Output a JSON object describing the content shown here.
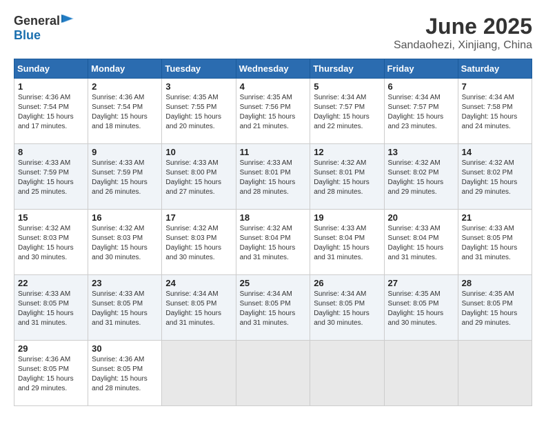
{
  "header": {
    "logo_general": "General",
    "logo_blue": "Blue",
    "title": "June 2025",
    "subtitle": "Sandaohezi, Xinjiang, China"
  },
  "calendar": {
    "days_of_week": [
      "Sunday",
      "Monday",
      "Tuesday",
      "Wednesday",
      "Thursday",
      "Friday",
      "Saturday"
    ],
    "weeks": [
      [
        null,
        {
          "day": "2",
          "sunrise": "4:36 AM",
          "sunset": "7:54 PM",
          "daylight": "15 hours and 18 minutes."
        },
        {
          "day": "3",
          "sunrise": "4:35 AM",
          "sunset": "7:55 PM",
          "daylight": "15 hours and 20 minutes."
        },
        {
          "day": "4",
          "sunrise": "4:35 AM",
          "sunset": "7:56 PM",
          "daylight": "15 hours and 21 minutes."
        },
        {
          "day": "5",
          "sunrise": "4:34 AM",
          "sunset": "7:57 PM",
          "daylight": "15 hours and 22 minutes."
        },
        {
          "day": "6",
          "sunrise": "4:34 AM",
          "sunset": "7:57 PM",
          "daylight": "15 hours and 23 minutes."
        },
        {
          "day": "7",
          "sunrise": "4:34 AM",
          "sunset": "7:58 PM",
          "daylight": "15 hours and 24 minutes."
        }
      ],
      [
        {
          "day": "1",
          "sunrise": "4:36 AM",
          "sunset": "7:54 PM",
          "daylight": "15 hours and 17 minutes."
        },
        null,
        null,
        null,
        null,
        null,
        null
      ],
      [
        {
          "day": "8",
          "sunrise": "4:33 AM",
          "sunset": "7:59 PM",
          "daylight": "15 hours and 25 minutes."
        },
        {
          "day": "9",
          "sunrise": "4:33 AM",
          "sunset": "7:59 PM",
          "daylight": "15 hours and 26 minutes."
        },
        {
          "day": "10",
          "sunrise": "4:33 AM",
          "sunset": "8:00 PM",
          "daylight": "15 hours and 27 minutes."
        },
        {
          "day": "11",
          "sunrise": "4:33 AM",
          "sunset": "8:01 PM",
          "daylight": "15 hours and 28 minutes."
        },
        {
          "day": "12",
          "sunrise": "4:32 AM",
          "sunset": "8:01 PM",
          "daylight": "15 hours and 28 minutes."
        },
        {
          "day": "13",
          "sunrise": "4:32 AM",
          "sunset": "8:02 PM",
          "daylight": "15 hours and 29 minutes."
        },
        {
          "day": "14",
          "sunrise": "4:32 AM",
          "sunset": "8:02 PM",
          "daylight": "15 hours and 29 minutes."
        }
      ],
      [
        {
          "day": "15",
          "sunrise": "4:32 AM",
          "sunset": "8:03 PM",
          "daylight": "15 hours and 30 minutes."
        },
        {
          "day": "16",
          "sunrise": "4:32 AM",
          "sunset": "8:03 PM",
          "daylight": "15 hours and 30 minutes."
        },
        {
          "day": "17",
          "sunrise": "4:32 AM",
          "sunset": "8:03 PM",
          "daylight": "15 hours and 30 minutes."
        },
        {
          "day": "18",
          "sunrise": "4:32 AM",
          "sunset": "8:04 PM",
          "daylight": "15 hours and 31 minutes."
        },
        {
          "day": "19",
          "sunrise": "4:33 AM",
          "sunset": "8:04 PM",
          "daylight": "15 hours and 31 minutes."
        },
        {
          "day": "20",
          "sunrise": "4:33 AM",
          "sunset": "8:04 PM",
          "daylight": "15 hours and 31 minutes."
        },
        {
          "day": "21",
          "sunrise": "4:33 AM",
          "sunset": "8:05 PM",
          "daylight": "15 hours and 31 minutes."
        }
      ],
      [
        {
          "day": "22",
          "sunrise": "4:33 AM",
          "sunset": "8:05 PM",
          "daylight": "15 hours and 31 minutes."
        },
        {
          "day": "23",
          "sunrise": "4:33 AM",
          "sunset": "8:05 PM",
          "daylight": "15 hours and 31 minutes."
        },
        {
          "day": "24",
          "sunrise": "4:34 AM",
          "sunset": "8:05 PM",
          "daylight": "15 hours and 31 minutes."
        },
        {
          "day": "25",
          "sunrise": "4:34 AM",
          "sunset": "8:05 PM",
          "daylight": "15 hours and 31 minutes."
        },
        {
          "day": "26",
          "sunrise": "4:34 AM",
          "sunset": "8:05 PM",
          "daylight": "15 hours and 30 minutes."
        },
        {
          "day": "27",
          "sunrise": "4:35 AM",
          "sunset": "8:05 PM",
          "daylight": "15 hours and 30 minutes."
        },
        {
          "day": "28",
          "sunrise": "4:35 AM",
          "sunset": "8:05 PM",
          "daylight": "15 hours and 29 minutes."
        }
      ],
      [
        {
          "day": "29",
          "sunrise": "4:36 AM",
          "sunset": "8:05 PM",
          "daylight": "15 hours and 29 minutes."
        },
        {
          "day": "30",
          "sunrise": "4:36 AM",
          "sunset": "8:05 PM",
          "daylight": "15 hours and 28 minutes."
        },
        null,
        null,
        null,
        null,
        null
      ]
    ]
  }
}
